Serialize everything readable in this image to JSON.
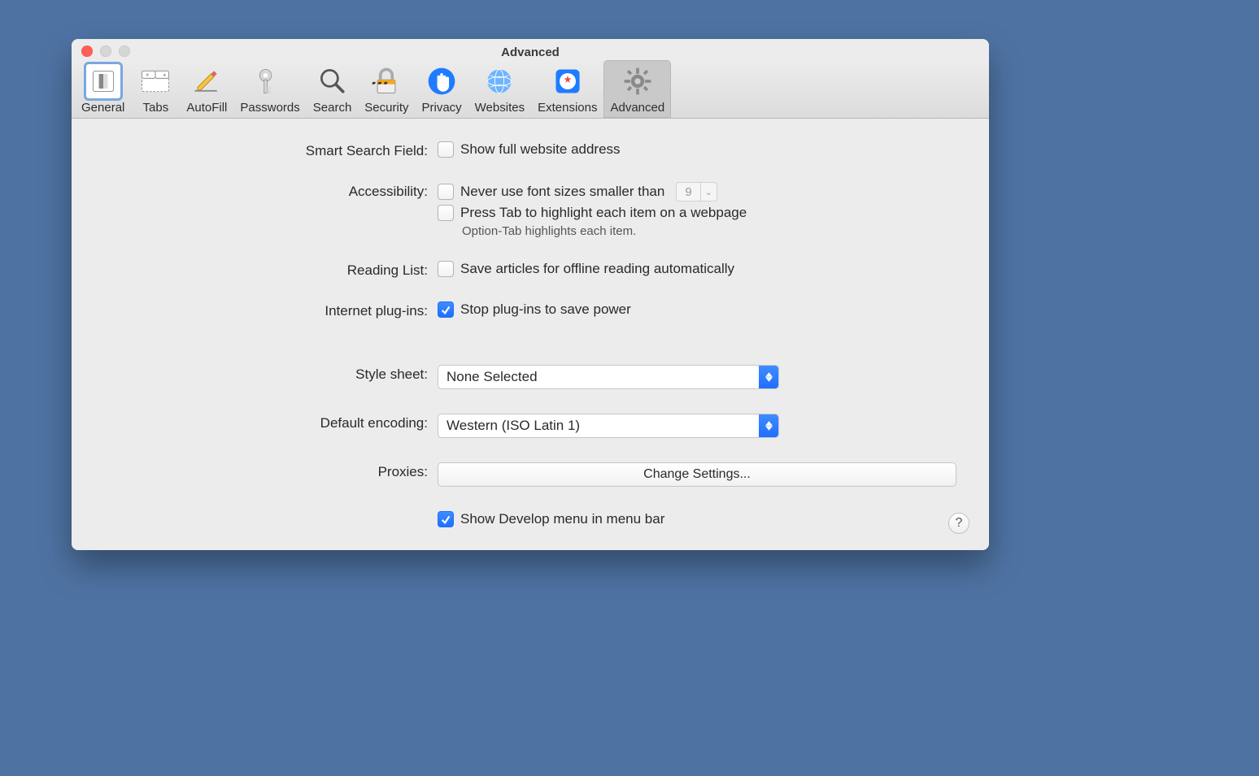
{
  "window": {
    "title": "Advanced"
  },
  "toolbar": {
    "tabs": [
      {
        "label": "General"
      },
      {
        "label": "Tabs"
      },
      {
        "label": "AutoFill"
      },
      {
        "label": "Passwords"
      },
      {
        "label": "Search"
      },
      {
        "label": "Security"
      },
      {
        "label": "Privacy"
      },
      {
        "label": "Websites"
      },
      {
        "label": "Extensions"
      },
      {
        "label": "Advanced"
      }
    ]
  },
  "sections": {
    "smart_search": {
      "label": "Smart Search Field:",
      "cb_show_full_address": "Show full website address"
    },
    "accessibility": {
      "label": "Accessibility:",
      "cb_font_size": "Never use font sizes smaller than",
      "font_size_value": "9",
      "cb_tab_highlight": "Press Tab to highlight each item on a webpage",
      "hint": "Option-Tab highlights each item."
    },
    "reading_list": {
      "label": "Reading List:",
      "cb_save_offline": "Save articles for offline reading automatically"
    },
    "plugins": {
      "label": "Internet plug-ins:",
      "cb_stop_plugins": "Stop plug-ins to save power"
    },
    "style_sheet": {
      "label": "Style sheet:",
      "value": "None Selected"
    },
    "default_encoding": {
      "label": "Default encoding:",
      "value": "Western (ISO Latin 1)"
    },
    "proxies": {
      "label": "Proxies:",
      "button": "Change Settings..."
    },
    "develop": {
      "cb_show_develop": "Show Develop menu in menu bar"
    }
  },
  "help": "?"
}
